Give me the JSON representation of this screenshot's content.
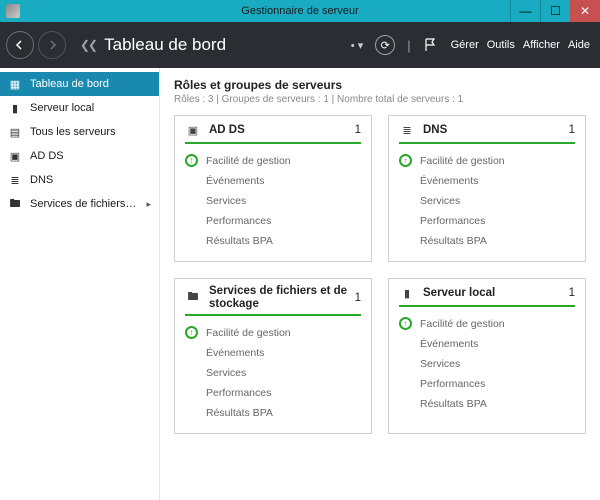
{
  "window": {
    "title": "Gestionnaire de serveur"
  },
  "header": {
    "page_title": "Tableau de bord",
    "menus": {
      "manage": "Gérer",
      "tools": "Outils",
      "view": "Afficher",
      "help": "Aide"
    }
  },
  "sidebar": {
    "items": [
      {
        "label": "Tableau de bord",
        "icon": "dashboard",
        "active": true
      },
      {
        "label": "Serveur local",
        "icon": "server"
      },
      {
        "label": "Tous les serveurs",
        "icon": "servers"
      },
      {
        "label": "AD DS",
        "icon": "adds"
      },
      {
        "label": "DNS",
        "icon": "dns"
      },
      {
        "label": "Services de fichiers et d...",
        "icon": "files",
        "expandable": true
      }
    ]
  },
  "section": {
    "title": "Rôles et groupes de serveurs",
    "subtitle": "Rôles : 3   |   Groupes de serveurs : 1   |   Nombre total de serveurs : 1"
  },
  "tile_links": {
    "manageability": "Facilité de gestion",
    "events": "Événements",
    "services": "Services",
    "performance": "Performances",
    "bpa": "Résultats BPA"
  },
  "tiles": [
    {
      "title": "AD DS",
      "count": 1,
      "icon": "adds"
    },
    {
      "title": "DNS",
      "count": 1,
      "icon": "dns"
    },
    {
      "title": "Services de fichiers et de stockage",
      "count": 1,
      "icon": "files"
    },
    {
      "title": "Serveur local",
      "count": 1,
      "icon": "server"
    }
  ]
}
